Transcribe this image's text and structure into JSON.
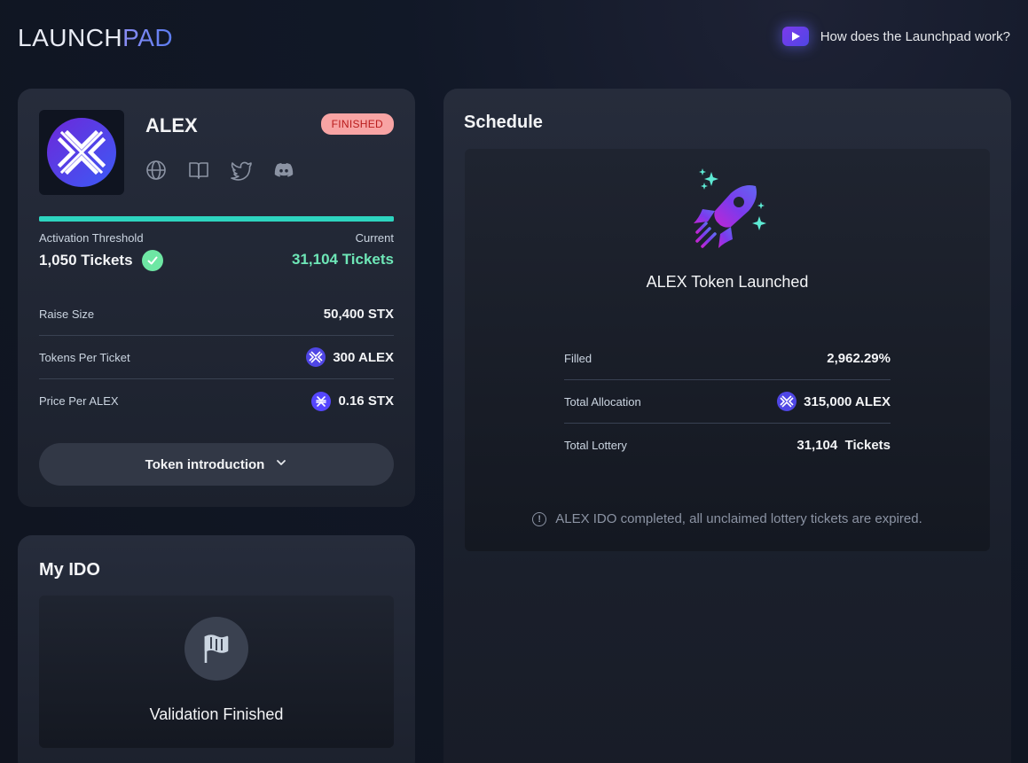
{
  "header": {
    "brand_part1": "LAUNCH",
    "brand_part2": "PAD",
    "howto_label": "How does the Launchpad work?"
  },
  "token_card": {
    "name": "ALEX",
    "status_badge": "FINISHED",
    "social_icons": [
      "globe-icon",
      "book-icon",
      "twitter-icon",
      "discord-icon"
    ],
    "progress_fraction": 1.0,
    "activation_threshold_label": "Activation Threshold",
    "activation_threshold_value": "1,050 Tickets",
    "current_label": "Current",
    "current_value": "31,104 Tickets",
    "rows": [
      {
        "label": "Raise Size",
        "value": "50,400 STX"
      },
      {
        "label": "Tokens Per Ticket",
        "value": "300 ALEX"
      },
      {
        "label": "Price Per ALEX",
        "value": "0.16 STX"
      }
    ],
    "intro_button_label": "Token introduction"
  },
  "my_ido": {
    "title": "My IDO",
    "status_text": "Validation Finished"
  },
  "schedule": {
    "title": "Schedule",
    "launched_text": "ALEX Token Launched",
    "rows": [
      {
        "label": "Filled",
        "value": "2,962.29%"
      },
      {
        "label": "Total Allocation",
        "value": "315,000 ALEX"
      },
      {
        "label": "Total Lottery",
        "value": "31,104  Tickets"
      }
    ],
    "note": "ALEX IDO completed, all unclaimed lottery tickets are expired."
  },
  "colors": {
    "accent_teal": "#2dd4bf",
    "current_green": "#6ee7b7",
    "badge_bg": "#f8a4a4",
    "badge_text": "#b91c1c",
    "brand_purple": "#7c3aed"
  }
}
